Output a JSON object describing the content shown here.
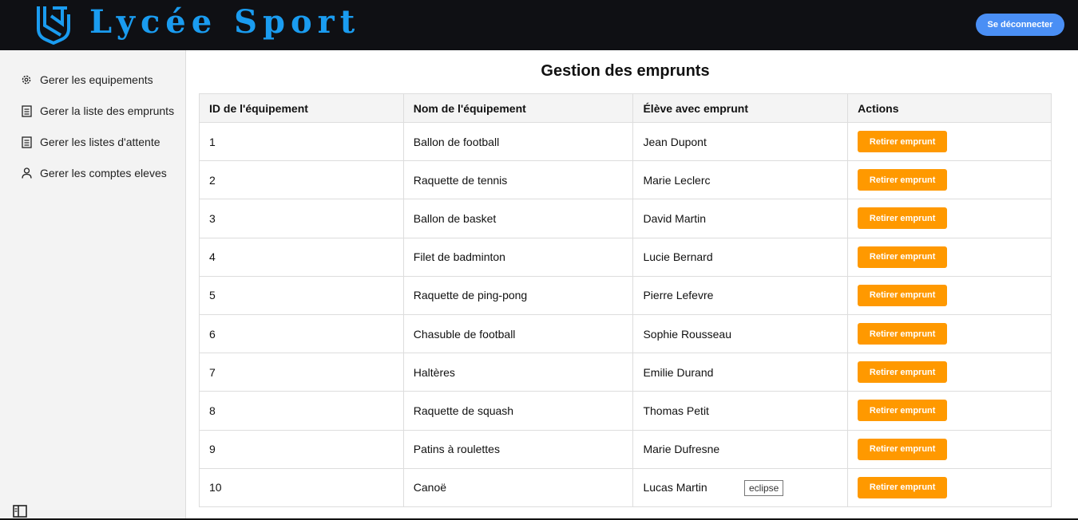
{
  "header": {
    "brand": "Lycée Sport",
    "logout_label": "Se déconnecter",
    "brand_color": "#1a9cf0",
    "logout_color": "#4a8ff5"
  },
  "sidebar": {
    "items": [
      {
        "label": "Gerer les equipements",
        "icon": "gear-icon"
      },
      {
        "label": "Gerer la liste des emprunts",
        "icon": "document-list-icon"
      },
      {
        "label": "Gerer les listes d'attente",
        "icon": "document-list-icon"
      },
      {
        "label": "Gerer les comptes eleves",
        "icon": "user-icon"
      }
    ],
    "toggle_icon": "sidebar-toggle-icon"
  },
  "main": {
    "title": "Gestion des emprunts",
    "columns": [
      "ID de l'équipement",
      "Nom de l'équipement",
      "Élève avec emprunt",
      "Actions"
    ],
    "action_label": "Retirer emprunt",
    "action_color": "#ff9900",
    "rows": [
      {
        "id": "1",
        "name": "Ballon de football",
        "student": "Jean Dupont"
      },
      {
        "id": "2",
        "name": "Raquette de tennis",
        "student": "Marie Leclerc"
      },
      {
        "id": "3",
        "name": "Ballon de basket",
        "student": "David Martin"
      },
      {
        "id": "4",
        "name": "Filet de badminton",
        "student": "Lucie Bernard"
      },
      {
        "id": "5",
        "name": "Raquette de ping-pong",
        "student": "Pierre Lefevre"
      },
      {
        "id": "6",
        "name": "Chasuble de football",
        "student": "Sophie Rousseau"
      },
      {
        "id": "7",
        "name": "Haltères",
        "student": "Emilie Durand"
      },
      {
        "id": "8",
        "name": "Raquette de squash",
        "student": "Thomas Petit"
      },
      {
        "id": "9",
        "name": "Patins à roulettes",
        "student": "Marie Dufresne"
      },
      {
        "id": "10",
        "name": "Canoë",
        "student": "Lucas Martin"
      }
    ],
    "tooltip": "eclipse"
  }
}
